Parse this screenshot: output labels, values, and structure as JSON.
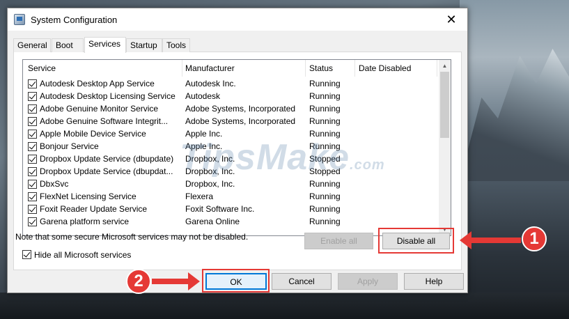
{
  "window": {
    "title": "System Configuration",
    "close_glyph": "✕",
    "icon": "msconfig-icon"
  },
  "tabs": [
    {
      "label": "General",
      "active": false
    },
    {
      "label": "Boot",
      "active": false
    },
    {
      "label": "Services",
      "active": true
    },
    {
      "label": "Startup",
      "active": false
    },
    {
      "label": "Tools",
      "active": false
    }
  ],
  "services_table": {
    "columns": [
      "Service",
      "Manufacturer",
      "Status",
      "Date Disabled"
    ],
    "rows": [
      {
        "checked": true,
        "service": "Autodesk Desktop App Service",
        "manufacturer": "Autodesk Inc.",
        "status": "Running",
        "date_disabled": ""
      },
      {
        "checked": true,
        "service": "Autodesk Desktop Licensing Service",
        "manufacturer": "Autodesk",
        "status": "Running",
        "date_disabled": ""
      },
      {
        "checked": true,
        "service": "Adobe Genuine Monitor Service",
        "manufacturer": "Adobe Systems, Incorporated",
        "status": "Running",
        "date_disabled": ""
      },
      {
        "checked": true,
        "service": "Adobe Genuine Software Integrit...",
        "manufacturer": "Adobe Systems, Incorporated",
        "status": "Running",
        "date_disabled": ""
      },
      {
        "checked": true,
        "service": "Apple Mobile Device Service",
        "manufacturer": "Apple Inc.",
        "status": "Running",
        "date_disabled": ""
      },
      {
        "checked": true,
        "service": "Bonjour Service",
        "manufacturer": "Apple Inc.",
        "status": "Running",
        "date_disabled": ""
      },
      {
        "checked": true,
        "service": "Dropbox Update Service (dbupdate)",
        "manufacturer": "Dropbox, Inc.",
        "status": "Stopped",
        "date_disabled": ""
      },
      {
        "checked": true,
        "service": "Dropbox Update Service (dbupdat...",
        "manufacturer": "Dropbox, Inc.",
        "status": "Stopped",
        "date_disabled": ""
      },
      {
        "checked": true,
        "service": "DbxSvc",
        "manufacturer": "Dropbox, Inc.",
        "status": "Running",
        "date_disabled": ""
      },
      {
        "checked": true,
        "service": "FlexNet Licensing Service",
        "manufacturer": "Flexera",
        "status": "Running",
        "date_disabled": ""
      },
      {
        "checked": true,
        "service": "Foxit Reader Update Service",
        "manufacturer": "Foxit Software Inc.",
        "status": "Running",
        "date_disabled": ""
      },
      {
        "checked": true,
        "service": "Garena platform service",
        "manufacturer": "Garena Online",
        "status": "Running",
        "date_disabled": ""
      }
    ]
  },
  "note": "Note that some secure Microsoft services may not be disabled.",
  "buttons": {
    "enable_all": "Enable all",
    "disable_all": "Disable all",
    "ok": "OK",
    "cancel": "Cancel",
    "apply": "Apply",
    "help": "Help"
  },
  "hide_ms": {
    "label": "Hide all Microsoft services",
    "checked": true
  },
  "annotations": {
    "step1": "1",
    "step2": "2",
    "color": "#e53935"
  },
  "watermark": {
    "text": "TipsMake",
    "suffix": ".com"
  }
}
